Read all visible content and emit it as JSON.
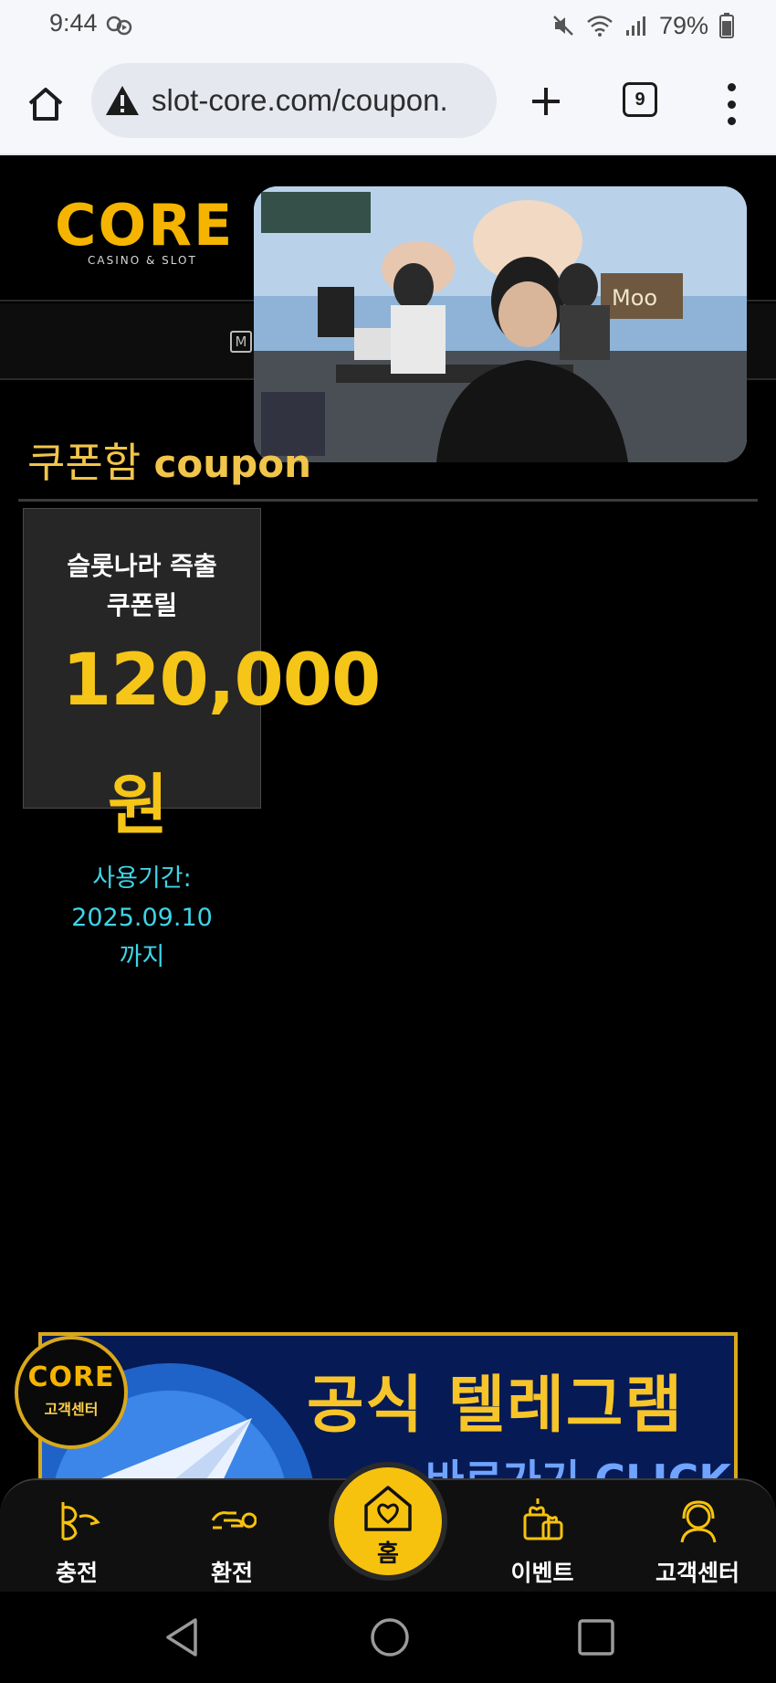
{
  "status_bar": {
    "time": "9:44",
    "battery": "79%"
  },
  "browser": {
    "url": "slot-core.com/coupon.",
    "tab_count": "9"
  },
  "site": {
    "logo_text": "CORE",
    "logo_subtitle": "CASINO & SLOT",
    "nav_icon_letter": "M"
  },
  "coupon": {
    "title": "쿠폰함",
    "title_en": "coupon",
    "card": {
      "name_line1": "슬롯나라 즉출",
      "name_line2": "쿠폰릴",
      "amount": "120,000",
      "unit": "원",
      "expiry_label": "사용기간:",
      "expiry_date": "2025.09.10",
      "expiry_suffix": "까지"
    }
  },
  "banner": {
    "title": "공식 텔레그램",
    "subtitle": "바로가기 CLICK"
  },
  "cs_badge": {
    "logo": "CORE",
    "label": "고객센터"
  },
  "bottom_nav": {
    "deposit": "충전",
    "withdraw": "환전",
    "home": "홈",
    "event": "이벤트",
    "support": "고객센터"
  },
  "colors": {
    "accent_gold": "#f5c518",
    "expiry_cyan": "#3fd4e8",
    "background": "#000000"
  }
}
